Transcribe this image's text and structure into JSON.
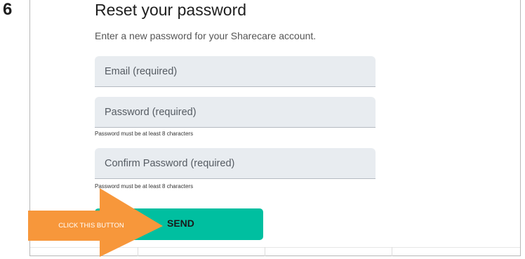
{
  "step": {
    "number": "6"
  },
  "form": {
    "title": "Reset your password",
    "subtitle": "Enter a new password for your Sharecare account.",
    "email": {
      "placeholder": "Email (required)",
      "value": ""
    },
    "password": {
      "placeholder": "Password (required)",
      "value": "",
      "helper": "Password must be at least 8 characters"
    },
    "confirm_password": {
      "placeholder": "Confirm Password (required)",
      "value": "",
      "helper": "Password must be at least 8 characters"
    },
    "send_label": "SEND"
  },
  "callout": {
    "label": "CLICK THIS BUTTON",
    "icon": "arrow-right-icon",
    "color": "#f7973b"
  },
  "colors": {
    "send_button": "#00bfa0",
    "field_background": "#e8ecf0"
  }
}
